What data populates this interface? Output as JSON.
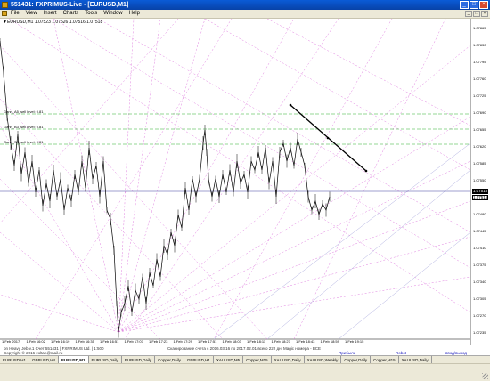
{
  "window": {
    "title": "551431: FXPRIMUS-Live - [EURUSD,M1]",
    "buttons": [
      "_",
      "□",
      "×"
    ]
  },
  "menu": [
    "File",
    "View",
    "Insert",
    "Charts",
    "Tools",
    "Window",
    "Help"
  ],
  "mdi_buttons": [
    "_",
    "□",
    "×"
  ],
  "chart": {
    "symbol_label": "▼EURUSD,M1  1.07523 1.07526 1.07516 1.07518",
    "gann_labels": [
      "Gann_A5_sell level: 0.81",
      "Gann_B3_sell level: 0.81",
      "Gann_S4_sell level: 0.81"
    ],
    "current_price": "1.07518",
    "bid_price": "1.07515",
    "price_levels": [
      "1.07865",
      "1.07830",
      "1.07795",
      "1.07760",
      "1.07725",
      "1.07690",
      "1.07655",
      "1.07620",
      "1.07585",
      "1.07550",
      "1.07515",
      "1.07480",
      "1.07445",
      "1.07410",
      "1.07375",
      "1.07340",
      "1.07305",
      "1.07270",
      "1.07235"
    ],
    "time_labels": [
      "1 Feb 2017",
      "1 Feb 16:02",
      "1 Feb 16:19",
      "1 Feb 16:35",
      "1 Feb 16:51",
      "1 Feb 17:07",
      "1 Feb 17:23",
      "1 Feb 17:29",
      "1 Feb 17:51",
      "1 Feb 18:03",
      "1 Feb 18:11",
      "1 Feb 18:27",
      "1 Feb 18:43",
      "1 Feb 18:59",
      "1 Feb 19:15"
    ]
  },
  "bottom_info": {
    "left": "on Heavy Jeb v.1   Счет 551431 | FXPRIMUS Ltd. | 1:500",
    "copyright": "Copyright © 2016 zoltan@mail.ru",
    "middle": "Сканирование счета с 2016.03.16 по 2017.02.01 всего 222 дн.",
    "magic": "Magic номера - ВСЕ",
    "profit": "Прибыль",
    "robot": "Robot",
    "deposit": "ввод/вывод"
  },
  "tabs": [
    "EURUSD,H1",
    "GBPUSD,H4",
    "EURUSD,M1",
    "EURUSD,Daily",
    "EURUSD,Daily",
    "Copper,Daily",
    "GBPUSD,H1",
    "XAUUSD,M5",
    "Copper,M15",
    "XAUUSD,Daily",
    "XAUUSD,Weekly",
    "Copper,Daily",
    "Copper,M15",
    "XAUUSD,Daily"
  ],
  "active_tab": 2
}
